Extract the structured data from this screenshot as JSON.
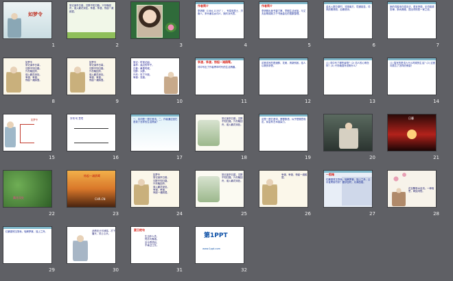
{
  "slides": [
    {
      "n": "1",
      "type": "title",
      "title": "如梦令",
      "bg": "#dfe9ec"
    },
    {
      "n": "2",
      "type": "text-green",
      "text": "常记溪亭日暮，沉醉不知归路。兴尽晚回舟，误入藕花深处。争渡，争渡，惊起一滩鸥鹭。"
    },
    {
      "n": "3",
      "type": "portrait",
      "bg": "#2f6b3a"
    },
    {
      "n": "4",
      "type": "text-white",
      "heading": "作者简介",
      "text": "李清照（1084-1155？），号易安居士，济南人。宋代著名女词人，婉约派代表。"
    },
    {
      "n": "5",
      "type": "text-white",
      "heading": "作者简介",
      "text": "李清照出身书香门第，早期生活优裕，与丈夫赵明诚致力于书画金石的搜集整理。"
    },
    {
      "n": "6",
      "type": "text-white",
      "heading": "",
      "text": "金兵入据中原时，流寓南方，境遇孤苦。词风前期清丽，后期悲凉。"
    },
    {
      "n": "7",
      "type": "text-white",
      "heading": "",
      "text": "她的词善用白描手法，语言清丽，论词强调协律，崇尚典雅，提出词别是一家之说。"
    },
    {
      "n": "8",
      "type": "poem-lady",
      "text": "如梦令\n常记溪亭日暮，\n沉醉不知归路。\n兴尽晚回舟，\n误入藕花深处。\n争渡，争渡，\n惊起一滩鸥鹭。"
    },
    {
      "n": "9",
      "type": "poem-lady",
      "text": "如梦令\n常记溪亭日暮，\n沉醉不知归路。\n兴尽晚回舟，\n误入藕花深处。\n争渡，争渡，\n惊起一滩鸥鹭。"
    },
    {
      "n": "10",
      "type": "notes",
      "text": "常记：时常记起。\n溪亭：溪边的亭子。\n日暮：黄昏时候。\n沉醉：大醉。\n兴尽：尽了兴致。\n争渡：怎渡。"
    },
    {
      "n": "11",
      "type": "text-white",
      "heading": "争渡，争渡，惊起一滩鸥鹭。",
      "text": "词中写出了作者青年时代的生活情趣。"
    },
    {
      "n": "12",
      "type": "text-white",
      "heading": "",
      "text": "这首词写的是酒醉、花美，清新别致，给人以美的享受。"
    },
    {
      "n": "13",
      "type": "text-white",
      "heading": "",
      "text": "(1) 词中写了哪些景物？(2) 词人的心情怎样？(3) 兴尽晚回舟说明什么？"
    },
    {
      "n": "14",
      "type": "text-white",
      "heading": "",
      "text": "(1) 描写的是词人什么时候的生活？(2) 这首词表达了怎样的情感？"
    },
    {
      "n": "15",
      "type": "diagram",
      "text": "如梦令"
    },
    {
      "n": "16",
      "type": "diagram2",
      "text": "字词 句 意境"
    },
    {
      "n": "17",
      "type": "text-blue",
      "text": "一、本词是一首忆昔词。二、作者通过回忆表现了怎样的生活情景？"
    },
    {
      "n": "18",
      "type": "poem-boat",
      "text": "常记溪亭日暮，沉醉不知归路。兴尽晚回舟，误入藕花深处。"
    },
    {
      "n": "19",
      "type": "text-white",
      "heading": "",
      "text": "这是一首忆昔词，寥寥数语，似乎是随意而出，却富有艺术感染力。"
    },
    {
      "n": "20",
      "type": "photo",
      "text": "",
      "bg": "#4e5a52"
    },
    {
      "n": "21",
      "type": "sunset",
      "text": "日暮",
      "bg": "#b3221b"
    },
    {
      "n": "22",
      "type": "lotus",
      "text": "藕花深处",
      "bg": "#3f7a35"
    },
    {
      "n": "23",
      "type": "sunset2",
      "text": "惊起一滩鸥鹭",
      "bg": "#c9782a"
    },
    {
      "n": "24",
      "type": "poem-lady",
      "text": "如梦令\n常记溪亭日暮，\n沉醉不知归路。\n兴尽晚回舟，\n误入藕花深处。\n争渡，争渡，\n惊起一滩鸥鹭。"
    },
    {
      "n": "25",
      "type": "poem-boat",
      "text": "常记溪亭日暮，沉醉不知归路。兴尽晚回舟，误入藕花深处。"
    },
    {
      "n": "26",
      "type": "poem-lady2",
      "text": "争渡，争渡，惊起一滩鸥鹭。"
    },
    {
      "n": "27",
      "type": "text-navy",
      "heading": "一剪梅",
      "text": "红藕香残玉簟秋。轻解罗裳，独上兰舟。云中谁寄锦书来？雁字回时，月满西楼。"
    },
    {
      "n": "28",
      "type": "poem-blossom",
      "text": "花自飘零水自流。一种相思，两处闲愁。"
    },
    {
      "n": "29",
      "type": "text-white",
      "heading": "",
      "text": "红藕香残玉簟秋。轻解罗裳，独上兰舟。"
    },
    {
      "n": "30",
      "type": "blossom-lady",
      "text": "此情无计可消除，才下眉头，却上心头。"
    },
    {
      "n": "31",
      "type": "poem-white",
      "heading": "夏日绝句",
      "text": "生当作人杰，\n死亦为鬼雄。\n至今思项羽，\n不肯过江东。"
    },
    {
      "n": "32",
      "type": "ppt-logo",
      "text": "第1PPT",
      "sub": "www.1ppt.com"
    }
  ],
  "watermarks": {
    "s23": "CHR.CN"
  }
}
